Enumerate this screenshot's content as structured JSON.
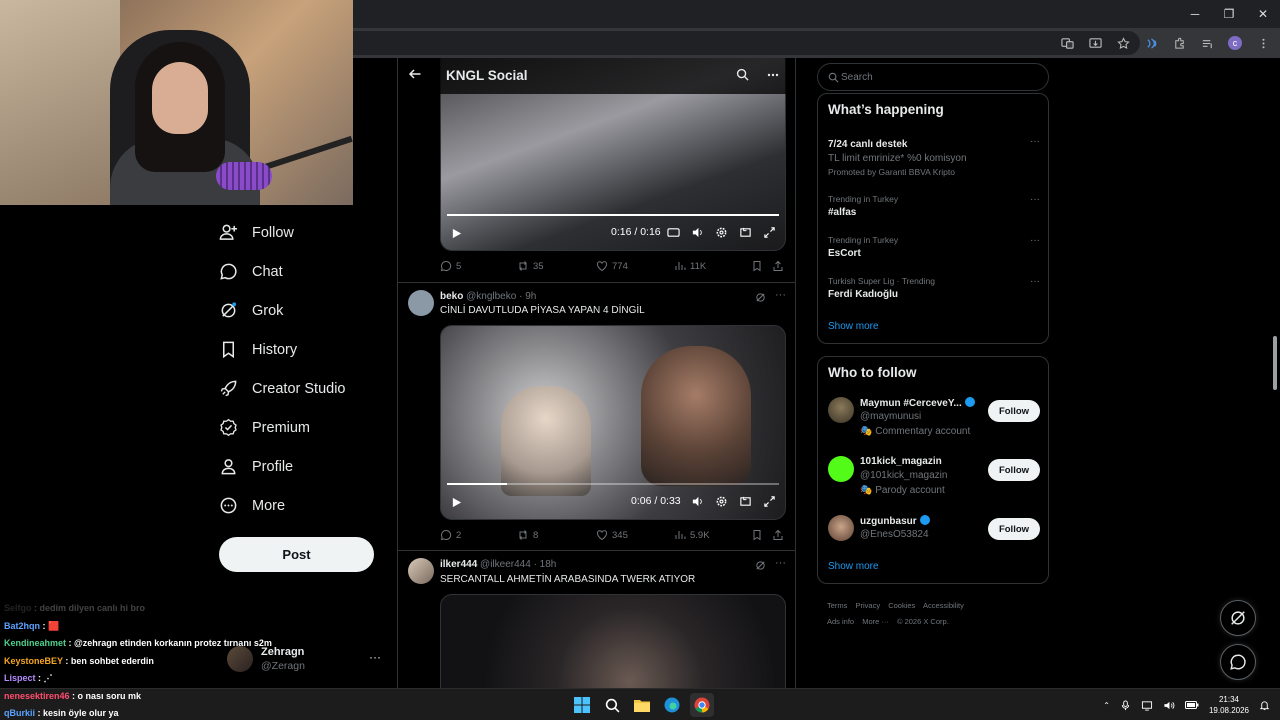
{
  "browser": {
    "window_controls": {
      "minimize": "─",
      "maximize": "❐",
      "close": "✕"
    },
    "profile_initial": "c"
  },
  "nav": {
    "items": [
      {
        "label": "Follow",
        "icon": "follow-icon"
      },
      {
        "label": "Chat",
        "icon": "chat-icon"
      },
      {
        "label": "Grok",
        "icon": "grok-icon"
      },
      {
        "label": "History",
        "icon": "bookmark-icon"
      },
      {
        "label": "Creator Studio",
        "icon": "rocket-icon"
      },
      {
        "label": "Premium",
        "icon": "verified-icon"
      },
      {
        "label": "Profile",
        "icon": "person-icon"
      },
      {
        "label": "More",
        "icon": "more-circle-icon"
      }
    ],
    "post_label": "Post"
  },
  "account": {
    "name": "Zehragn",
    "handle": "@Zeragn",
    "more": "···"
  },
  "chat": [
    {
      "user": "Selfgo",
      "text": "dedim dilyen canlı hi bro",
      "color": "#8a8a8a",
      "faded": true
    },
    {
      "user": "Bat2hqn",
      "text": "🟥",
      "color": "#5aa2ff"
    },
    {
      "user": "Kendineahmet",
      "text": "@zehragn etinden korkanın protez tırnanı s2m",
      "color": "#4fd18b"
    },
    {
      "user": "KeystoneBEY",
      "text": "ben sohbet ederdin",
      "color": "#f5a623"
    },
    {
      "user": "Lispect",
      "text": "⋰",
      "color": "#b58cff"
    },
    {
      "user": "nenesektiren46",
      "text": "o nası soru mk",
      "color": "#ff4d6d"
    },
    {
      "user": "qBurkii",
      "text": "kesin öyle olur ya",
      "color": "#5aa2ff"
    }
  ],
  "main": {
    "title": "KNGL Social",
    "tweets": [
      {
        "video": {
          "time": "0:16 / 0:16",
          "progress": 1.0
        },
        "actions": {
          "replies": "5",
          "reposts": "35",
          "likes": "774",
          "views": "11K"
        }
      },
      {
        "name": "beko",
        "handle": "@knglbeko",
        "time": "· 9h",
        "text": "CİNLİ DAVUTLUDA PİYASA YAPAN 4 DİNGİL",
        "video": {
          "time": "0:06 / 0:33",
          "progress": 0.18
        },
        "actions": {
          "replies": "2",
          "reposts": "8",
          "likes": "345",
          "views": "5.9K"
        }
      },
      {
        "name": "ilker444",
        "handle": "@ilkeer444",
        "time": "· 18h",
        "text": "SERCANTALL AHMETİN ARABASINDA TWERK ATIYOR"
      }
    ]
  },
  "right": {
    "search_placeholder": "Search",
    "whats_happening": {
      "title": "What’s happening",
      "trends": [
        {
          "category": "",
          "name": "7/24 canlı destek",
          "sub": "TL limit emrinize* %0 komisyon",
          "promo": "Promoted by Garanti BBVA Kripto"
        },
        {
          "category": "Trending in Turkey",
          "name": "#alfas"
        },
        {
          "category": "Trending in Turkey",
          "name": "EsCort"
        },
        {
          "category": "Turkish Super Lig · Trending",
          "name": "Ferdi Kadıoğlu"
        }
      ],
      "show_more": "Show more"
    },
    "who_to_follow": {
      "title": "Who to follow",
      "accounts": [
        {
          "name": "Maymun #CerceveY...",
          "handle": "@maymunusi",
          "label": "Commentary account",
          "verified": true,
          "follow": "Follow"
        },
        {
          "name": "101kick_magazin",
          "handle": "@101kick_magazin",
          "label": "Parody account",
          "verified": false,
          "follow": "Follow"
        },
        {
          "name": "uzgunbasur",
          "handle": "@EnesO53824",
          "label": "",
          "verified": true,
          "follow": "Follow"
        }
      ],
      "show_more": "Show more"
    },
    "footer": [
      "Terms",
      "Privacy",
      "Cookies",
      "Accessibility",
      "Ads info",
      "More ···",
      "© 2026 X Corp."
    ]
  },
  "taskbar": {
    "time": "21:34",
    "date": "19.08.2026"
  },
  "colors": {
    "accent": "#1d9bf0",
    "background": "#000000",
    "border": "#2f3336",
    "muted": "#71767b"
  }
}
